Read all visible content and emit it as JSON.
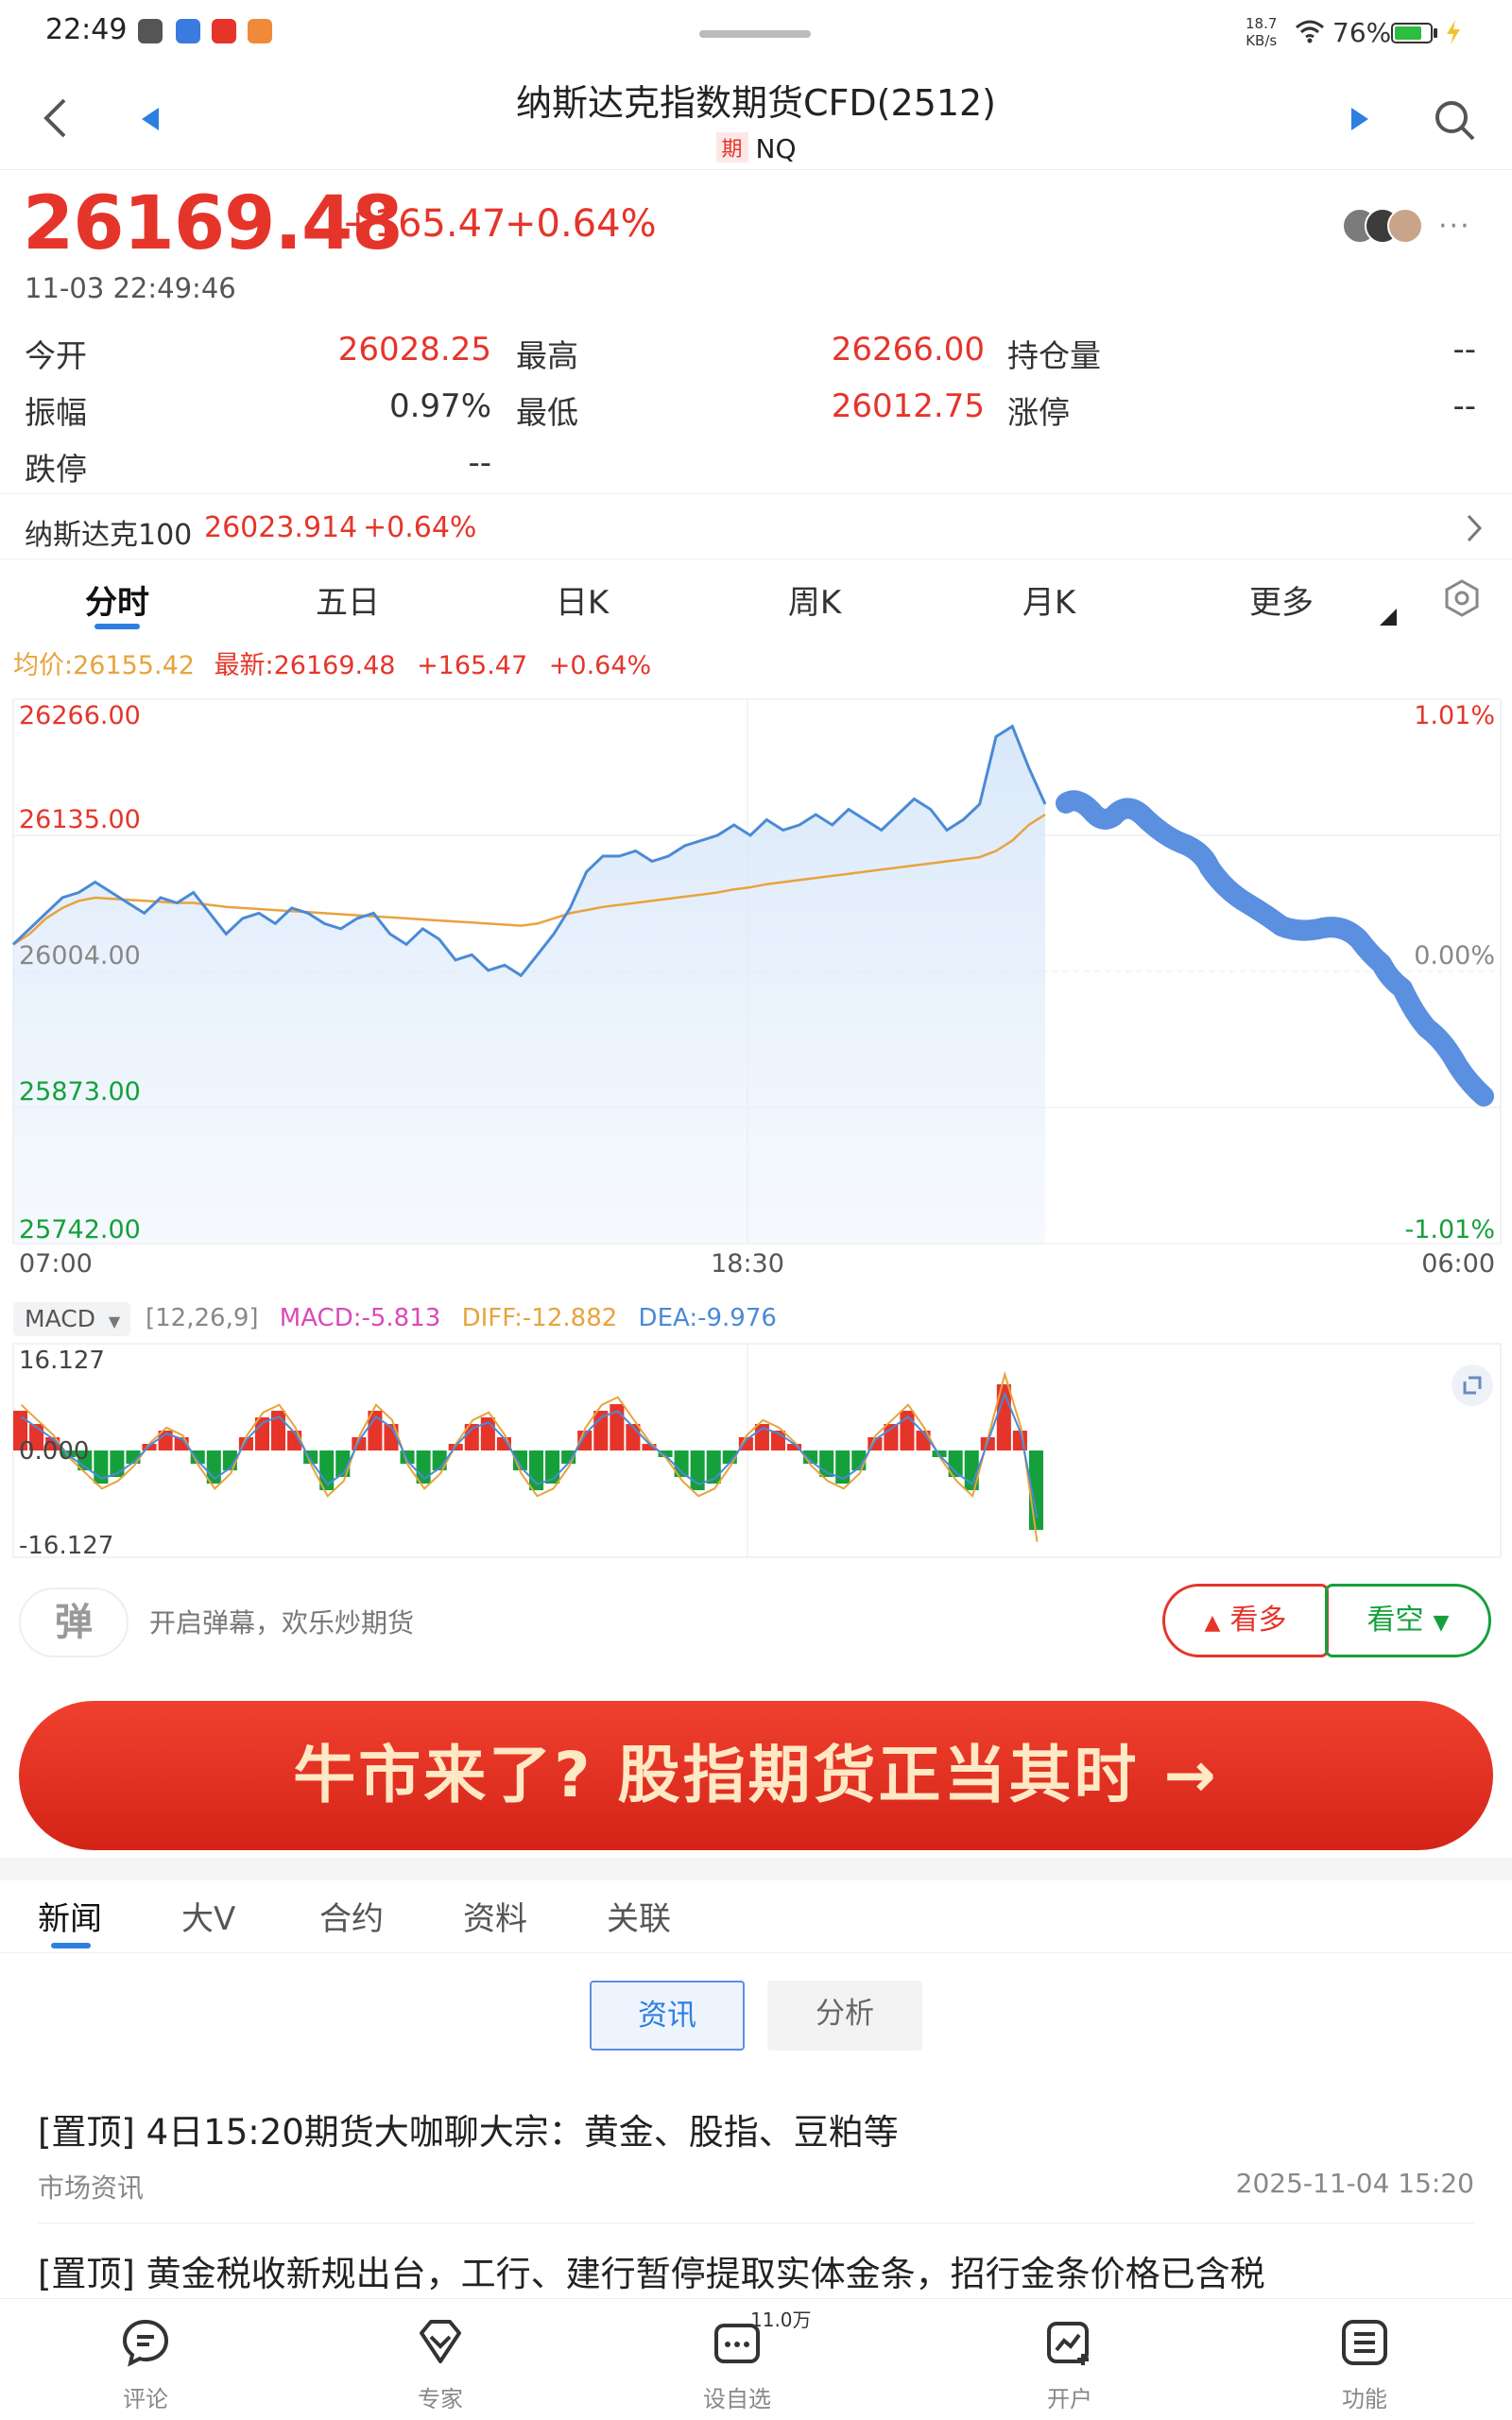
{
  "status_bar": {
    "time": "22:49",
    "net_speed_value": "18.7",
    "net_speed_unit": "KB/s",
    "battery": "76%"
  },
  "header": {
    "title": "纳斯达克指数期货CFD(2512)",
    "tag": "期",
    "code": "NQ"
  },
  "quote": {
    "price": "26169.48",
    "change": "+165.47",
    "change_pct": "+0.64%",
    "timestamp": "11-03 22:49:46"
  },
  "stats": {
    "open_label": "今开",
    "open": "26028.25",
    "high_label": "最高",
    "high": "26266.00",
    "oi_label": "持仓量",
    "oi": "--",
    "amp_label": "振幅",
    "amp": "0.97%",
    "low_label": "最低",
    "low": "26012.75",
    "limit_up_label": "涨停",
    "limit_up": "--",
    "limit_down_label": "跌停",
    "limit_down": "--"
  },
  "index_row": {
    "name": "纳斯达克100",
    "value": "26023.914",
    "change_pct": "+0.64%"
  },
  "chart_tabs": [
    "分时",
    "五日",
    "日K",
    "周K",
    "月K",
    "更多"
  ],
  "legend": {
    "avg": "均价:26155.42",
    "latest": "最新:26169.48",
    "chg": "+165.47",
    "pct": "+0.64%"
  },
  "colors": {
    "red": "#e5352b",
    "green": "#15a03c",
    "blue": "#2d7fe0",
    "avg_line": "#e8a33d",
    "price_line": "#4a8ad6"
  },
  "chart_data": [
    {
      "type": "line",
      "y_axis_left": [
        "26266.00",
        "26135.00",
        "26004.00",
        "25873.00",
        "25742.00"
      ],
      "y_axis_right": [
        "1.01%",
        "0.00%",
        "-1.01%"
      ],
      "x_ticks": [
        "07:00",
        "18:30",
        "06:00"
      ],
      "ylim": [
        25742,
        26266
      ],
      "baseline": 26004,
      "series": [
        {
          "values": [
            26030,
            26045,
            26060,
            26075,
            26080,
            26090,
            26080,
            26070,
            26060,
            26075,
            26070,
            26080,
            26060,
            26040,
            26055,
            26060,
            26050,
            26065,
            26060,
            26050,
            26045,
            26055,
            26060,
            26040,
            26030,
            26045,
            26035,
            26015,
            26020,
            26005,
            26010,
            26000,
            26020,
            26040,
            26065,
            26100,
            26115,
            26115,
            26120,
            26110,
            26115,
            26125,
            26130,
            26135,
            26145,
            26135,
            26150,
            26140,
            26145,
            26155,
            26145,
            26160,
            26150,
            26140,
            26155,
            26170,
            26160,
            26140,
            26150,
            26165,
            26230,
            26240,
            26200,
            26165
          ]
        },
        {
          "values": [
            26030,
            26040,
            26055,
            26065,
            26072,
            26075,
            26074,
            26073,
            26072,
            26071,
            26070,
            26070,
            26068,
            26066,
            26065,
            26064,
            26063,
            26062,
            26061,
            26060,
            26059,
            26058,
            26057,
            26056,
            26055,
            26054,
            26053,
            26052,
            26051,
            26050,
            26049,
            26048,
            26050,
            26055,
            26060,
            26063,
            26066,
            26068,
            26070,
            26072,
            26074,
            26076,
            26078,
            26080,
            26083,
            26085,
            26088,
            26090,
            26092,
            26094,
            26096,
            26098,
            26100,
            26102,
            26104,
            26106,
            26108,
            26110,
            26112,
            26114,
            26120,
            26130,
            26145,
            26155
          ]
        }
      ]
    },
    {
      "type": "bar",
      "title": "MACD",
      "params": "[12,26,9]",
      "macd": "MACD:-5.813",
      "diff": "DIFF:-12.882",
      "dea": "DEA:-9.976",
      "y_axis": [
        "16.127",
        "0.000",
        "-16.127"
      ],
      "ylim": [
        -16.127,
        16.127
      ],
      "values": [
        6,
        4,
        2,
        -1,
        -3,
        -5,
        -4,
        -2,
        1,
        3,
        2,
        -2,
        -5,
        -3,
        2,
        5,
        6,
        3,
        -2,
        -6,
        -4,
        2,
        6,
        4,
        -2,
        -5,
        -3,
        1,
        4,
        5,
        2,
        -3,
        -6,
        -5,
        -2,
        3,
        6,
        7,
        4,
        1,
        -1,
        -4,
        -6,
        -5,
        -2,
        2,
        4,
        3,
        1,
        -2,
        -4,
        -5,
        -3,
        2,
        4,
        6,
        3,
        -1,
        -4,
        -6,
        2,
        10,
        3,
        -12
      ]
    }
  ],
  "actions": {
    "danmu_icon": "弹",
    "danmu_text": "开启弹幕，欢乐炒期货",
    "bull": "看多",
    "bear": "看空"
  },
  "banner": {
    "text": "牛市来了? 股指期货正当其时 →"
  },
  "news_tabs": [
    "新闻",
    "大V",
    "合约",
    "资料",
    "关联"
  ],
  "sub_tabs": [
    "资讯",
    "分析"
  ],
  "news": [
    {
      "title": "[置顶] 4日15:20期货大咖聊大宗：黄金、股指、豆粕等",
      "source": "市场资讯",
      "time": "2025-11-04 15:20"
    },
    {
      "title": "[置顶] 黄金税收新规出台，工行、建行暂停提取实体金条，招行金条价格已含税"
    }
  ],
  "bottom_nav": [
    {
      "label": "评论",
      "icon": "comment-icon"
    },
    {
      "label": "专家",
      "icon": "expert-icon"
    },
    {
      "label": "设自选",
      "icon": "watchlist-icon",
      "badge": "11.0万"
    },
    {
      "label": "开户",
      "icon": "open-account-icon"
    },
    {
      "label": "功能",
      "icon": "menu-icon"
    }
  ]
}
